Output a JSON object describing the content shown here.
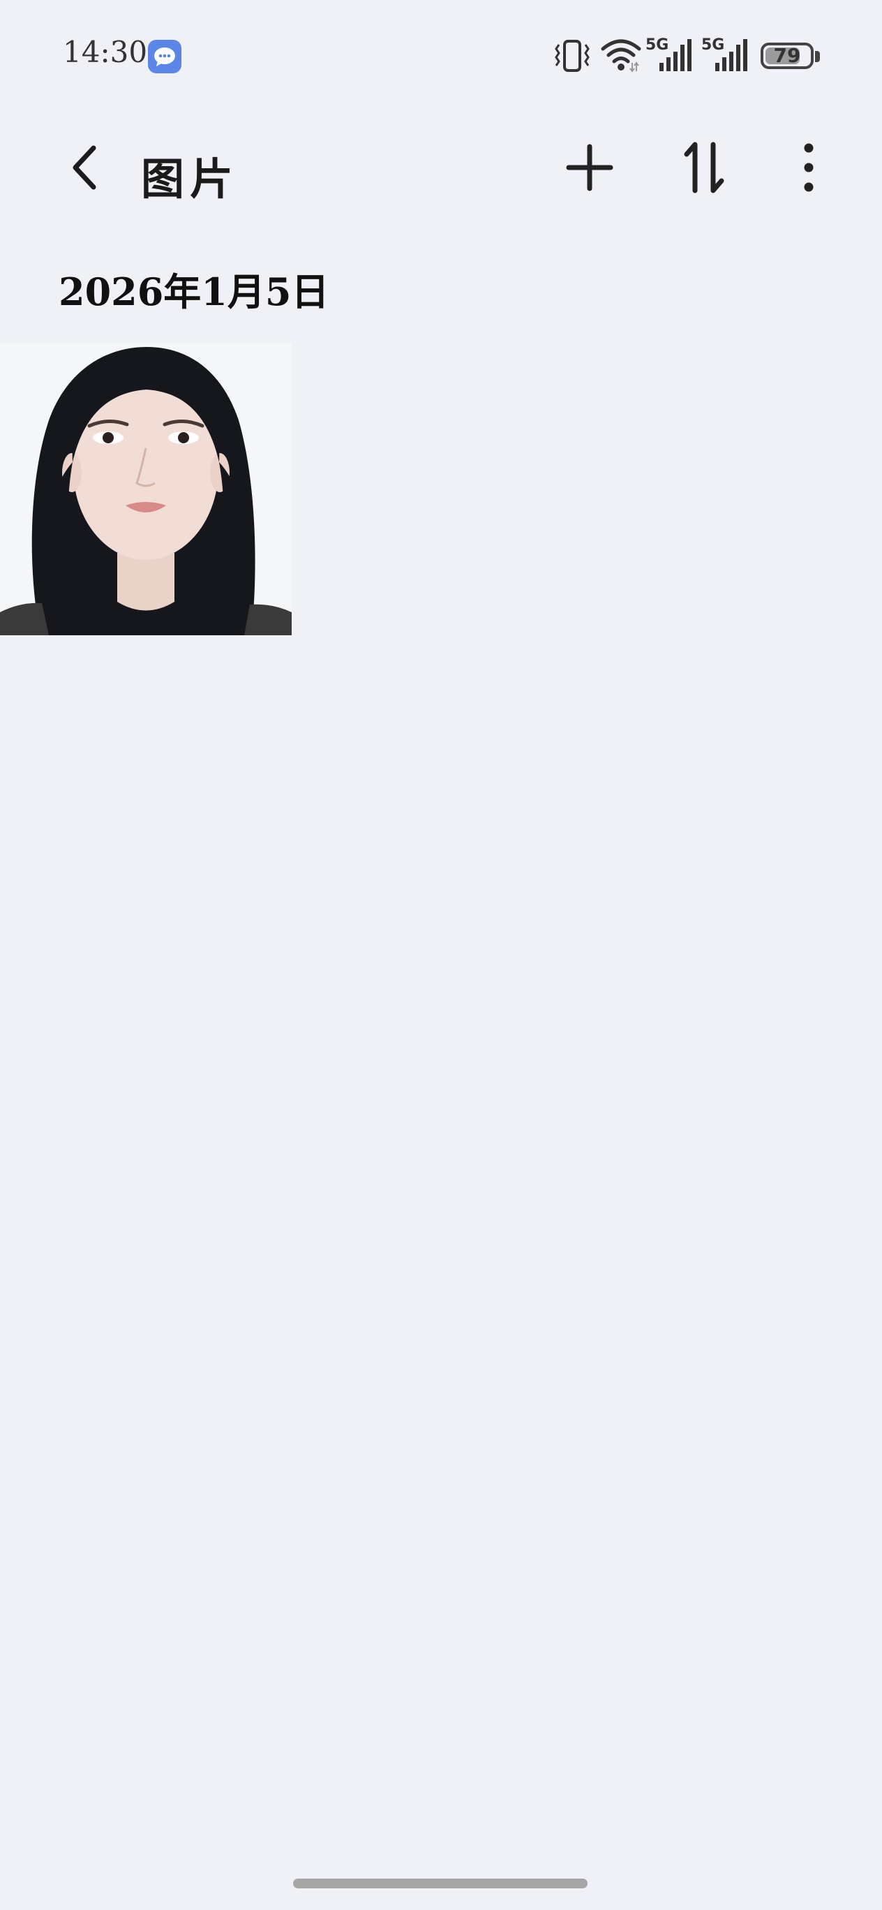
{
  "status_bar": {
    "time": "14:30",
    "notification_icon": "message-icon",
    "network_labels": [
      "5G",
      "5G"
    ],
    "battery_level": "79",
    "battery_fraction": 0.79
  },
  "toolbar": {
    "back_icon": "chevron-left-icon",
    "title": "图片",
    "add_icon": "plus-icon",
    "sort_icon": "sort-icon",
    "more_icon": "more-vertical-icon"
  },
  "gallery": {
    "groups": [
      {
        "date": "2026年1月5日",
        "photos": [
          {
            "name": "portrait-photo"
          }
        ]
      }
    ]
  },
  "colors": {
    "background": "#f0f1f6",
    "accent": "#5b86e8",
    "text": "#1b1b1b"
  }
}
